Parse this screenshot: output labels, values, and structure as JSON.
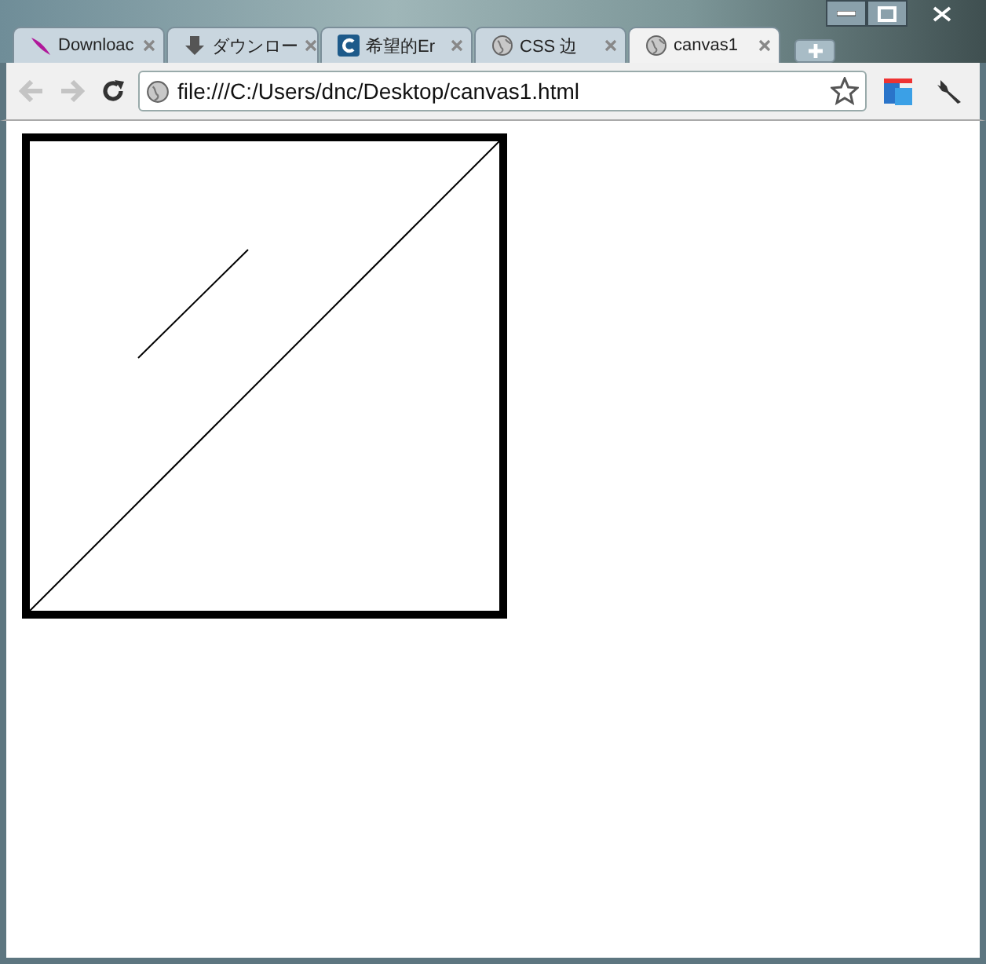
{
  "tabs": [
    {
      "title": "Downloac",
      "selected": false
    },
    {
      "title": "ダウンロー",
      "selected": false
    },
    {
      "title": "希望的Er",
      "selected": false
    },
    {
      "title": "CSS 边",
      "selected": false
    },
    {
      "title": "canvas1",
      "selected": true
    }
  ],
  "address_bar": {
    "value": "file:///C:/Users/dnc/Desktop/canvas1.html"
  }
}
